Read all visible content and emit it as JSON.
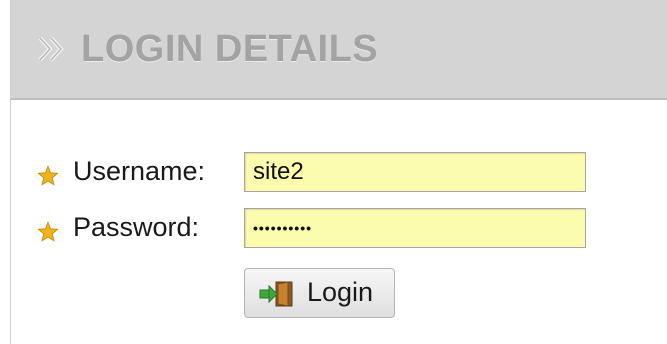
{
  "header": {
    "title": "LOGIN DETAILS",
    "icon": "double-chevron-right-icon"
  },
  "form": {
    "username": {
      "label": "Username:",
      "value": "site2",
      "icon": "star-icon"
    },
    "password": {
      "label": "Password:",
      "value": "••••••••••",
      "icon": "star-icon"
    }
  },
  "login_button": {
    "label": "Login",
    "icon": "door-enter-icon"
  },
  "colors": {
    "header_bg": "#d4d4d4",
    "header_text": "#a3a3a3",
    "field_bg": "#fcfcae",
    "star": "#f0b41e",
    "arrow_green": "#3fa63c"
  }
}
